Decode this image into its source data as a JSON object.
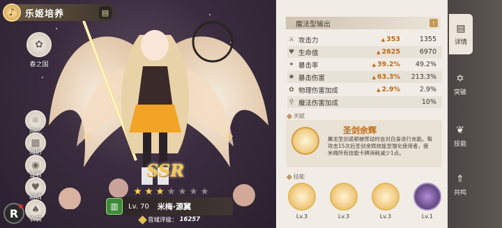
{
  "header": {
    "title": "乐姬培养",
    "badge_icon": "music-note-icon",
    "book_icon": "codex-icon"
  },
  "left_buttons": [
    {
      "name": "spring-kingdom",
      "label": "春之国",
      "icon": "flower-icon"
    },
    {
      "name": "memory",
      "label": "回忆",
      "icon": "molecule-icon"
    },
    {
      "name": "profile",
      "label": "简历",
      "icon": "document-icon"
    },
    {
      "name": "view",
      "label": "查看",
      "icon": "eye-icon"
    },
    {
      "name": "story",
      "label": "剧情",
      "icon": "heart-icon"
    },
    {
      "name": "outfit",
      "label": "衣装",
      "icon": "dress-icon"
    }
  ],
  "character": {
    "rarity": "SSR",
    "stars_filled": 3,
    "stars_total": 7,
    "level": "Lv. 70",
    "name": "米梅·源冀",
    "rating_label": "音域评级：",
    "rating_value": "16257"
  },
  "stats": {
    "section_title": "魔法型输出",
    "rows": [
      {
        "name": "攻击力",
        "icon": "sword-icon",
        "bonus": "353",
        "value": "1355"
      },
      {
        "name": "生命值",
        "icon": "heart-icon",
        "bonus": "2625",
        "value": "6970"
      },
      {
        "name": "暴击率",
        "icon": "crit-icon",
        "bonus": "39.2%",
        "value": "49.2%"
      },
      {
        "name": "暴击伤害",
        "icon": "crit-damage-icon",
        "bonus": "63.3%",
        "value": "213.3%"
      },
      {
        "name": "物理伤害加成",
        "icon": "physical-icon",
        "bonus": "2.9%",
        "value": "2.9%"
      },
      {
        "name": "魔法伤害加成",
        "icon": "magic-icon",
        "bonus": "",
        "value": "10%"
      }
    ]
  },
  "talent": {
    "tag": "天赋",
    "name": "圣剑余辉",
    "description": "屠龙圣剑诺顿被挥动时会对自身进行充能。每攻击15次后圣剑余辉效能显强化使用者，使米梅所有技能卡牌消耗减少1点。"
  },
  "skills": {
    "tag": "技能",
    "items": [
      {
        "level": "Lv.3",
        "style": "gold"
      },
      {
        "level": "Lv.3",
        "style": "gold"
      },
      {
        "level": "Lv.3",
        "style": "gold"
      },
      {
        "level": "Lv.1",
        "style": "purple"
      }
    ]
  },
  "tabs": [
    {
      "label": "详情",
      "icon": "book-icon",
      "active": true
    },
    {
      "label": "突破",
      "icon": "star-burst-icon",
      "active": false
    },
    {
      "label": "技能",
      "icon": "wing-icon",
      "active": false
    },
    {
      "label": "共鸣",
      "icon": "arrow-up-icon",
      "active": false
    }
  ],
  "colors": {
    "accent": "#c06a14",
    "panel_bg": "#f1ede6",
    "rail_bg": "#4e4945",
    "gold": "#f3c95e"
  }
}
